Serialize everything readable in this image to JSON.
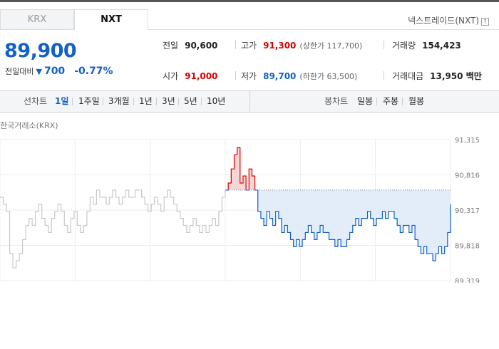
{
  "tabs": [
    {
      "label": "KRX",
      "active": false
    },
    {
      "label": "NXT",
      "active": true
    }
  ],
  "exchange_label": "넥스트레이드(NXT)",
  "help_icon": "question-mark-icon",
  "quote": {
    "price": "89,900",
    "change_label": "전일대비",
    "change_direction_icon": "down-triangle-icon",
    "change_amount": "700",
    "change_percent": "-0.77%"
  },
  "stats": {
    "prev_close": {
      "label": "전일",
      "value": "90,600"
    },
    "high": {
      "label": "고가",
      "value": "91,300",
      "sub": "(상한가 117,700)"
    },
    "volume": {
      "label": "거래량",
      "value": "154,423"
    },
    "open": {
      "label": "시가",
      "value": "91,000"
    },
    "low": {
      "label": "저가",
      "value": "89,700",
      "sub": "(하한가 63,500)"
    },
    "turnover": {
      "label": "거래대금",
      "value": "13,950 백만"
    }
  },
  "controls": {
    "line_chart_label": "선차트",
    "periods": [
      "1일",
      "1주일",
      "3개월",
      "1년",
      "3년",
      "5년",
      "10년"
    ],
    "active_period": "1일",
    "candle_chart_label": "봉차트",
    "candle_periods": [
      "일봉",
      "주봉",
      "월봉"
    ]
  },
  "chart_title": "한국거래소(KRX)",
  "colors": {
    "up": "#d60000",
    "down": "#1261c4",
    "fill_down": "#e3edfa",
    "krx_line": "#c8c8c8"
  },
  "chart_data": {
    "type": "line",
    "title": "한국거래소(KRX)",
    "y_ticks": [
      "91,315",
      "90,816",
      "90,317",
      "89,818",
      "89,319"
    ],
    "ylim": [
      89319,
      91315
    ],
    "reference_price": 90600,
    "grid": true,
    "series": [
      {
        "values": [
          90500,
          90400,
          90300,
          89700,
          89500,
          89600,
          89700,
          89900,
          90100,
          90200,
          90100,
          90300,
          90400,
          90200,
          90100,
          90000,
          90200,
          90300,
          90400,
          90300,
          90100,
          90000,
          90200,
          90300,
          90100,
          90000,
          90100,
          90300,
          90500,
          90400,
          90600,
          90500,
          90500,
          90400,
          90500,
          90600,
          90500,
          90400,
          90500,
          90600,
          90500,
          90500,
          90600,
          90600,
          90500,
          90400,
          90300,
          90400,
          90500,
          90400,
          90300,
          90500,
          90600,
          90500,
          90400,
          90300,
          90200,
          90100,
          90000,
          90100,
          90200,
          90100,
          90000,
          90100,
          90000,
          90100,
          90200,
          90100,
          90300,
          90500,
          90600
        ]
      },
      {
        "values": [
          90600,
          90700,
          90900,
          91100,
          91200,
          90700,
          90800,
          90600,
          90900,
          90800,
          90600,
          90300,
          90200,
          90100,
          90300,
          90200,
          90100,
          90300,
          90200,
          90000,
          90100,
          90000,
          89900,
          89800,
          89900,
          89800,
          89900,
          90000,
          90100,
          90000,
          89900,
          90000,
          90100,
          90000,
          90000,
          89900,
          89900,
          89800,
          89900,
          89800,
          89800,
          89900,
          90000,
          90100,
          90200,
          90100,
          90200,
          90200,
          90300,
          90200,
          90100,
          90200,
          90200,
          90300,
          90200,
          90300,
          90300,
          90200,
          90100,
          90000,
          90100,
          90100,
          90000,
          90100,
          89900,
          89800,
          89700,
          89800,
          89700,
          89700,
          89600,
          89700,
          89800,
          89700,
          89800,
          90000,
          90400
        ]
      }
    ]
  }
}
